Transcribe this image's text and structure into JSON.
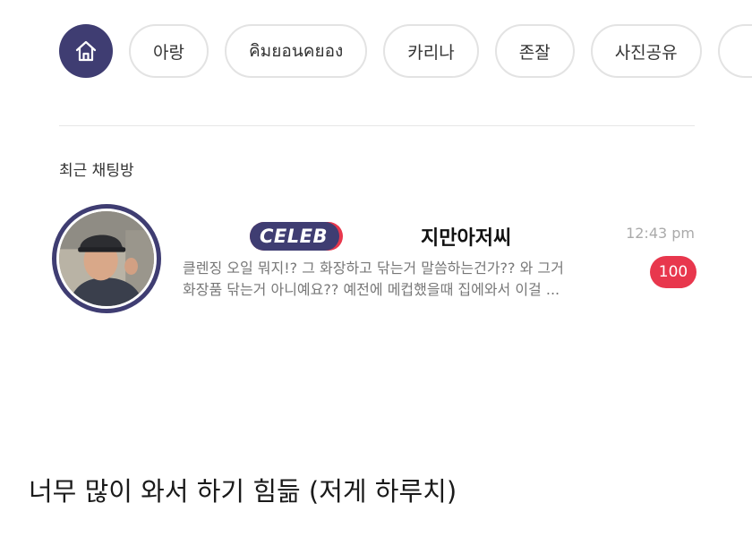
{
  "tabs": {
    "home_icon": "home-icon",
    "items": [
      "아랑",
      "คิมยอนคยอง",
      "카리나",
      "존잘",
      "사진공유"
    ]
  },
  "recent": {
    "section_title": "최근 채팅방",
    "chat": {
      "badge": "CELEB",
      "name": "지만아저씨",
      "time": "12:43 pm",
      "preview_line1": "클렌징 오일 뭐지!? 그 화장하고 닦는거 말씀하는건가?? 와 그거",
      "preview_line2": "화장품 닦는거 아니예요?? 예전에 메컵했을때 집에와서 이걸 ...",
      "unread_count": "100"
    }
  },
  "caption": "너무 많이 와서 하기 힘듦 (저게 하루치)",
  "colors": {
    "accent": "#3f3d72",
    "badge_red": "#e8374d"
  }
}
